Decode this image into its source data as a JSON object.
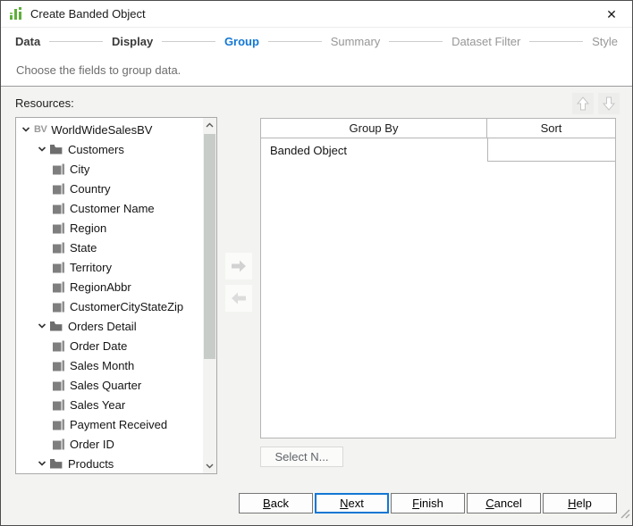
{
  "window": {
    "title": "Create Banded Object",
    "close_glyph": "✕"
  },
  "wizard": {
    "steps": [
      {
        "label": "Data",
        "state": "done"
      },
      {
        "label": "Display",
        "state": "done"
      },
      {
        "label": "Group",
        "state": "active"
      },
      {
        "label": "Summary",
        "state": "todo"
      },
      {
        "label": "Dataset Filter",
        "state": "todo"
      },
      {
        "label": "Style",
        "state": "todo"
      }
    ]
  },
  "subtitle": "Choose the fields to group data.",
  "resources": {
    "label": "Resources:",
    "tree": [
      {
        "label": "WorldWideSalesBV",
        "type": "bv",
        "level": 0,
        "expanded": true
      },
      {
        "label": "Customers",
        "type": "folder",
        "level": 1,
        "expanded": true
      },
      {
        "label": "City",
        "type": "field",
        "level": 2
      },
      {
        "label": "Country",
        "type": "field",
        "level": 2
      },
      {
        "label": "Customer Name",
        "type": "field",
        "level": 2
      },
      {
        "label": "Region",
        "type": "field",
        "level": 2
      },
      {
        "label": "State",
        "type": "field",
        "level": 2
      },
      {
        "label": "Territory",
        "type": "field",
        "level": 2
      },
      {
        "label": "RegionAbbr",
        "type": "field",
        "level": 2
      },
      {
        "label": "CustomerCityStateZip",
        "type": "field",
        "level": 2
      },
      {
        "label": "Orders Detail",
        "type": "folder",
        "level": 1,
        "expanded": true
      },
      {
        "label": "Order Date",
        "type": "field",
        "level": 2
      },
      {
        "label": "Sales Month",
        "type": "field",
        "level": 2
      },
      {
        "label": "Sales Quarter",
        "type": "field",
        "level": 2
      },
      {
        "label": "Sales Year",
        "type": "field",
        "level": 2
      },
      {
        "label": "Payment Received",
        "type": "field",
        "level": 2
      },
      {
        "label": "Order ID",
        "type": "field",
        "level": 2
      },
      {
        "label": "Products",
        "type": "folder",
        "level": 1,
        "expanded": true
      },
      {
        "label": "",
        "type": "field",
        "level": 2
      }
    ]
  },
  "group_panel": {
    "columns": [
      "Group By",
      "Sort"
    ],
    "rows": [
      {
        "group_by": "Banded Object",
        "sort": ""
      }
    ],
    "select_n_label": "Select N..."
  },
  "footer": {
    "buttons": [
      {
        "label": "Back",
        "default": false
      },
      {
        "label": "Next",
        "default": true
      },
      {
        "label": "Finish",
        "default": false
      },
      {
        "label": "Cancel",
        "default": false
      },
      {
        "label": "Help",
        "default": false
      }
    ]
  },
  "colors": {
    "accent_blue": "#1377d4",
    "title_icon_green": "#5fae3c",
    "disabled_gray": "#d2d2d2"
  }
}
